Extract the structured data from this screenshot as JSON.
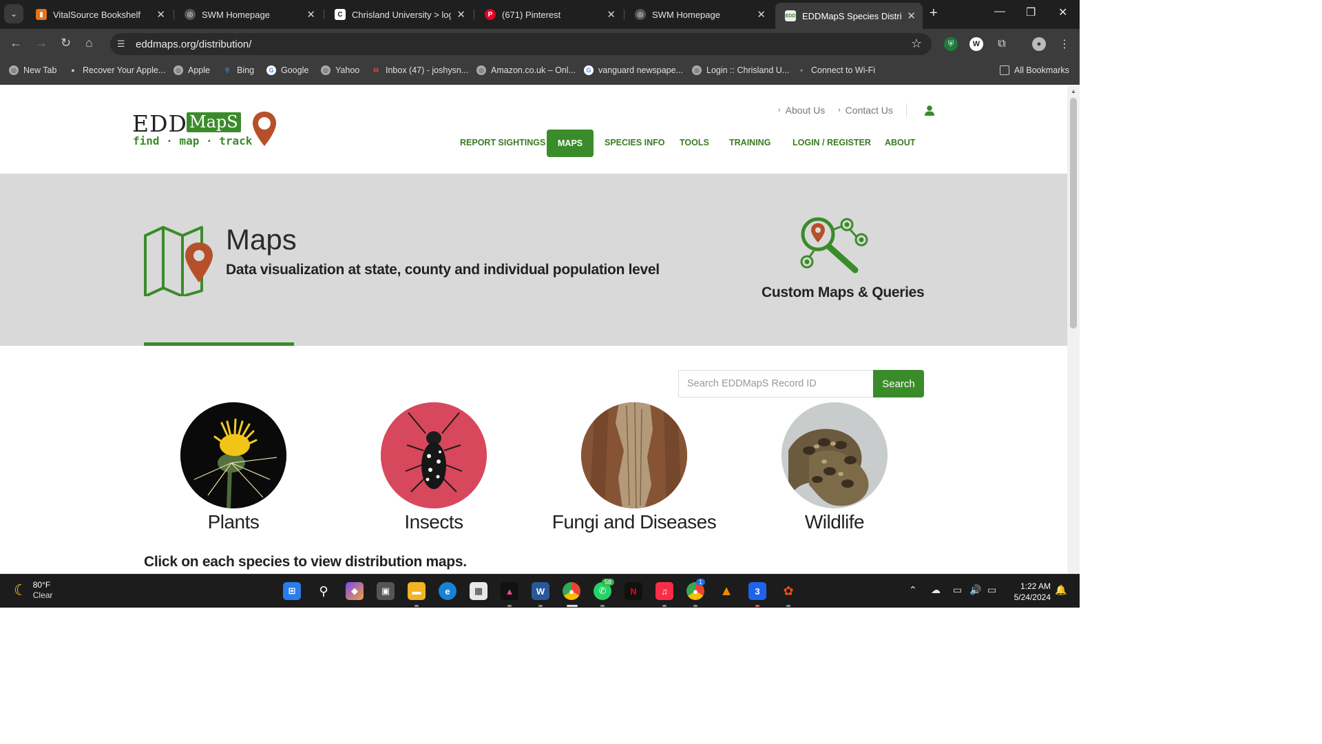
{
  "browser": {
    "tabs": [
      {
        "title": "VitalSource Bookshelf",
        "icon": "vitalsource-icon"
      },
      {
        "title": "SWM Homepage",
        "icon": "globe-icon"
      },
      {
        "title": "Chrisland University > login",
        "icon": "chrisland-icon"
      },
      {
        "title": "(671) Pinterest",
        "icon": "pinterest-icon"
      },
      {
        "title": "SWM Homepage",
        "icon": "globe-icon"
      },
      {
        "title": "EDDMapS Species Distribu",
        "icon": "eddmaps-icon",
        "active": true
      }
    ],
    "url": "eddmaps.org/distribution/",
    "bookmarks": [
      {
        "label": "New Tab"
      },
      {
        "label": "Recover Your Apple..."
      },
      {
        "label": "Apple"
      },
      {
        "label": "Bing"
      },
      {
        "label": "Google"
      },
      {
        "label": "Yahoo"
      },
      {
        "label": "Inbox (47) - joshysn..."
      },
      {
        "label": "Amazon.co.uk – Onl..."
      },
      {
        "label": "vanguard newspape..."
      },
      {
        "label": "Login :: Chrisland U..."
      },
      {
        "label": "Connect to Wi-Fi"
      }
    ],
    "all_bookmarks": "All Bookmarks"
  },
  "site": {
    "logo": {
      "edd": "EDD",
      "maps": "MapS",
      "tagline": "find · map · track"
    },
    "util_links": [
      "About Us",
      "Contact Us"
    ],
    "nav": [
      {
        "label": "REPORT SIGHTINGS"
      },
      {
        "label": "MAPS",
        "active": true
      },
      {
        "label": "SPECIES INFO"
      },
      {
        "label": "TOOLS"
      },
      {
        "label": "TRAINING"
      },
      {
        "label": "LOGIN / REGISTER"
      },
      {
        "label": "ABOUT"
      }
    ],
    "hero": {
      "title": "Maps",
      "subtitle": "Data visualization at state, county and individual population level",
      "custom_label": "Custom Maps & Queries"
    },
    "search": {
      "placeholder": "Search EDDMapS Record ID",
      "button": "Search"
    },
    "categories": [
      {
        "label": "Plants"
      },
      {
        "label": "Insects"
      },
      {
        "label": "Fungi and Diseases"
      },
      {
        "label": "Wildlife"
      }
    ],
    "instruction": "Click on each species to view distribution maps."
  },
  "taskbar": {
    "weather": {
      "temp": "80°F",
      "condition": "Clear"
    },
    "whatsapp_badge": "58",
    "chrome_badge": "1",
    "time": "1:22 AM",
    "date": "5/24/2024"
  },
  "colors": {
    "brand_green": "#3a8c2a",
    "pin_red": "#b5502a",
    "hero_bg": "#d9d9d9"
  }
}
